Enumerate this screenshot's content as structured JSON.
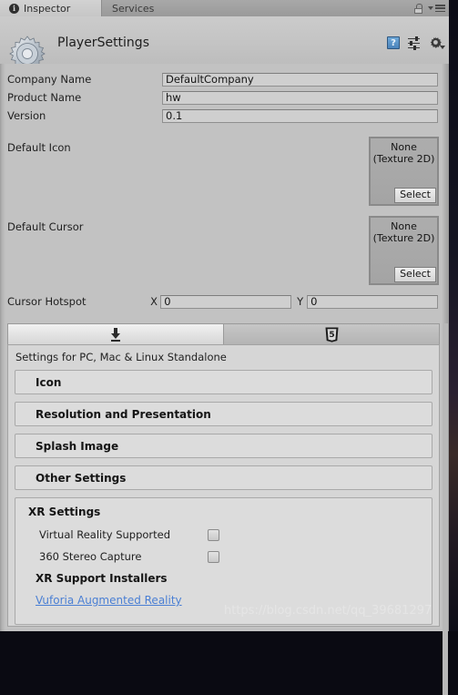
{
  "tabbar": {
    "tabs": [
      {
        "label": "Inspector",
        "icon": "info-icon",
        "active": true
      },
      {
        "label": "Services",
        "icon": "",
        "active": false
      }
    ],
    "lock_icon": "lock-icon",
    "menu_icon": "hamburger-menu-icon"
  },
  "header": {
    "title": "PlayerSettings",
    "logo_icon": "gear-icon",
    "help_icon": "help-book-icon",
    "help_glyph": "?",
    "preset_icon": "preset-sliders-icon",
    "settings_icon": "gear-dropdown-icon"
  },
  "properties": [
    {
      "label": "Company Name",
      "value": "DefaultCompany"
    },
    {
      "label": "Product Name",
      "value": "hw"
    },
    {
      "label": "Version",
      "value": "0.1"
    }
  ],
  "object_fields": [
    {
      "label": "Default Icon",
      "none_line1": "None",
      "none_line2": "(Texture 2D)",
      "select_label": "Select"
    },
    {
      "label": "Default Cursor",
      "none_line1": "None",
      "none_line2": "(Texture 2D)",
      "select_label": "Select"
    }
  ],
  "cursor_hotspot": {
    "label": "Cursor Hotspot",
    "x_label": "X",
    "x_value": "0",
    "y_label": "Y",
    "y_value": "0"
  },
  "platform_tabs": [
    {
      "icon": "standalone-download-icon",
      "selected": true
    },
    {
      "icon": "html5-webgl-icon",
      "selected": false
    }
  ],
  "settings": {
    "caption": "Settings for PC, Mac & Linux Standalone",
    "foldouts": [
      {
        "label": "Icon"
      },
      {
        "label": "Resolution and Presentation"
      },
      {
        "label": "Splash Image"
      },
      {
        "label": "Other Settings"
      }
    ],
    "xr": {
      "title": "XR Settings",
      "toggles": [
        {
          "label": "Virtual Reality Supported",
          "checked": false
        },
        {
          "label": "360 Stereo Capture",
          "checked": false
        }
      ],
      "installers_title": "XR Support Installers",
      "installer_link": "Vuforia Augmented Reality"
    }
  },
  "watermark": "https://blog.csdn.net/qq_39681297",
  "colors": {
    "panel_bg": "#c2c2c2",
    "section_bg": "#d6d6d6",
    "foldout_bg": "#dcdcdc",
    "link": "#4a7fd4",
    "field_bg": "#cfcfcf"
  }
}
